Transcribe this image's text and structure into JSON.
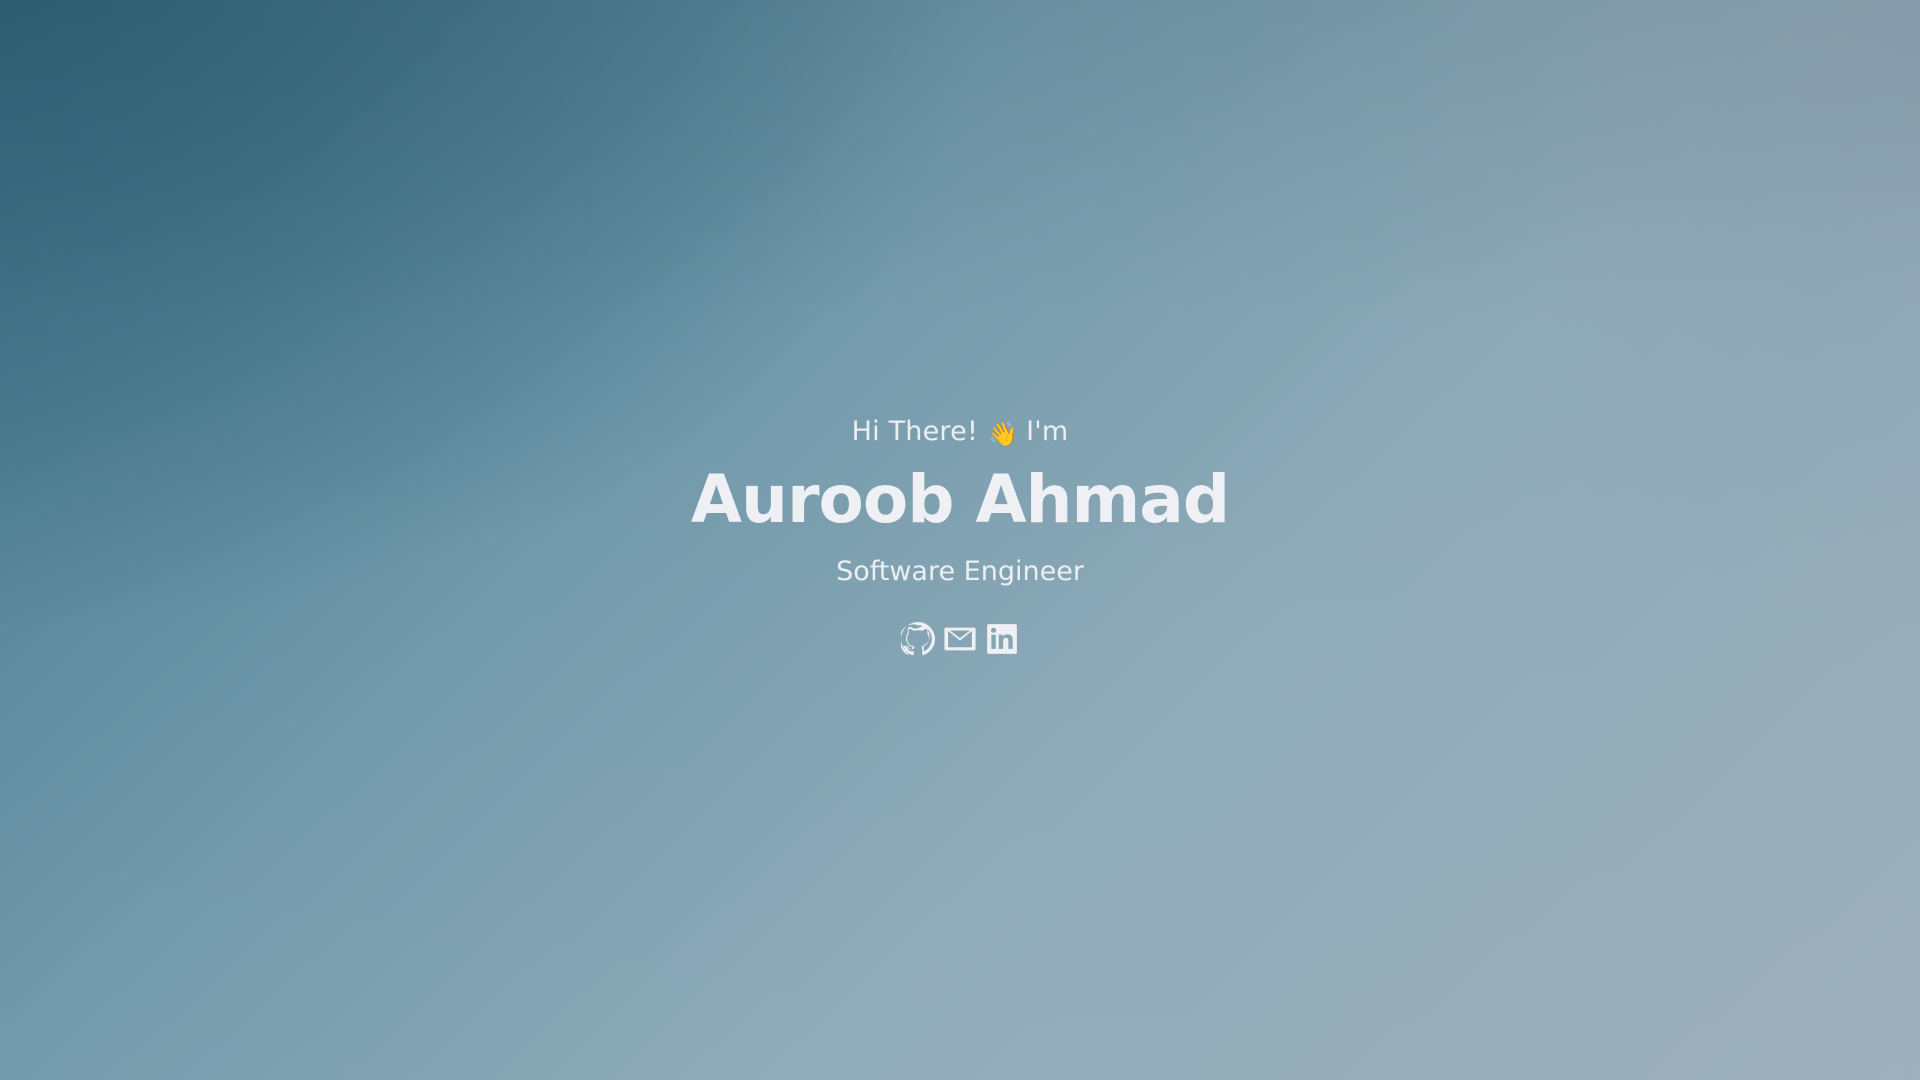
{
  "hero": {
    "greeting_prefix": "Hi There!",
    "wave_emoji": "👋",
    "greeting_suffix": "I'm",
    "name": "Auroob Ahmad",
    "role": "Software Engineer"
  },
  "socials": [
    {
      "icon": "github-icon",
      "label": "GitHub"
    },
    {
      "icon": "mail-icon",
      "label": "Email"
    },
    {
      "icon": "linkedin-icon",
      "label": "LinkedIn"
    }
  ],
  "colors": {
    "text": "#eceef1",
    "background_dark": "#3f7288",
    "background_light": "#9dafbb"
  }
}
